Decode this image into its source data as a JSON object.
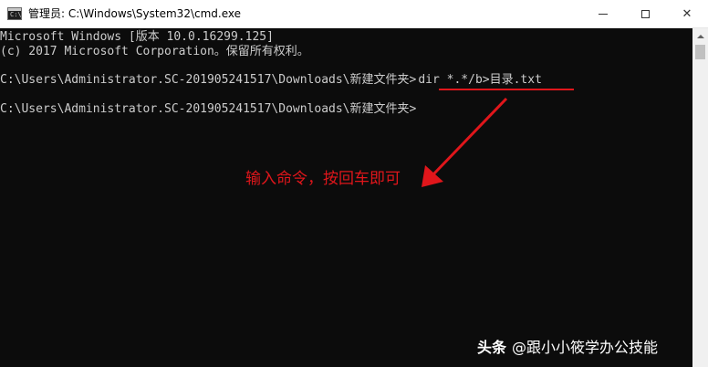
{
  "window": {
    "title": "管理员: C:\\Windows\\System32\\cmd.exe",
    "icon": "cmd-icon",
    "controls": {
      "minimize": "minimize-icon",
      "maximize": "maximize-icon",
      "close": "close-icon",
      "close_glyph": "✕"
    }
  },
  "console": {
    "lines": [
      "Microsoft Windows [版本 10.0.16299.125]",
      "(c) 2017 Microsoft Corporation。保留所有权利。",
      "C:\\Users\\Administrator.SC-201905241517\\Downloads\\新建文件夹>",
      "C:\\Users\\Administrator.SC-201905241517\\Downloads\\新建文件夹>"
    ],
    "command": "dir *.*/b>目录.txt"
  },
  "annotation": {
    "text": "输入命令，按回车即可",
    "color": "#e0161b"
  },
  "watermark": {
    "brand": "头条",
    "handle": "@跟小小筱学办公技能"
  },
  "colors": {
    "console_bg": "#0c0c0c",
    "console_text": "#cccccc",
    "titlebar_bg": "#ffffff"
  }
}
